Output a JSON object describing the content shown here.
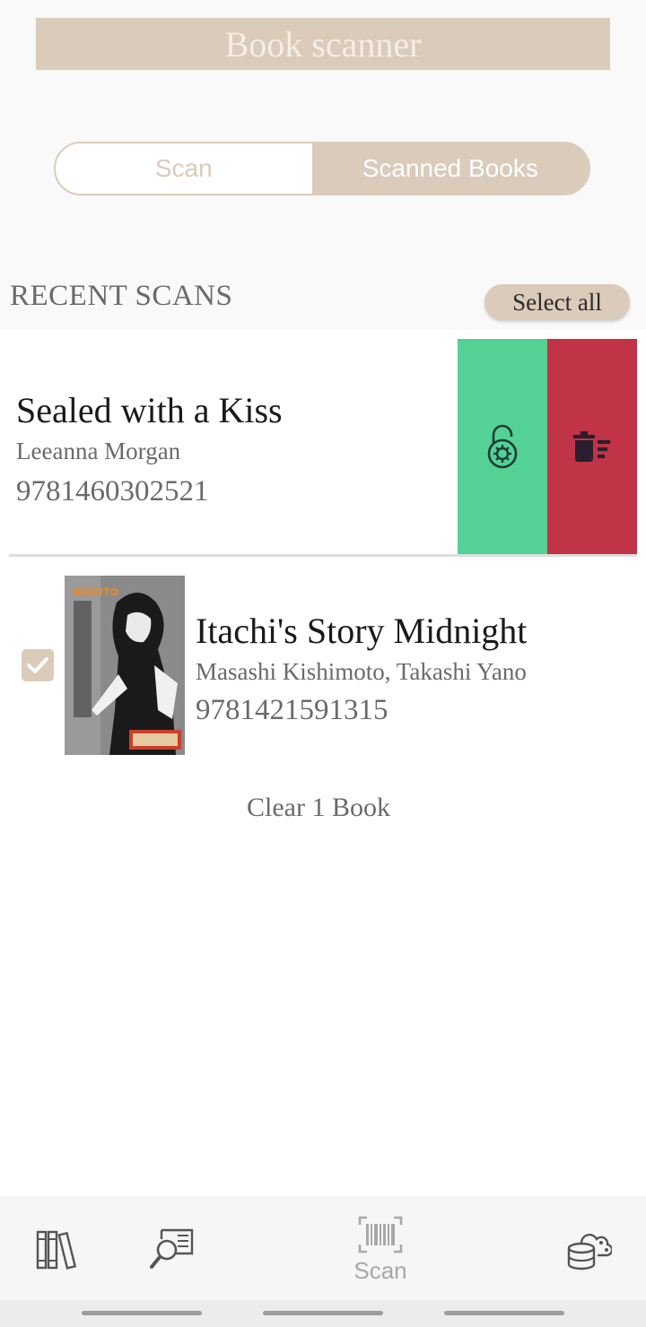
{
  "header": {
    "title": "Book scanner"
  },
  "tabs": {
    "scan": "Scan",
    "scanned_books": "Scanned Books"
  },
  "recent": {
    "label": "RECENT SCANS",
    "select_all": "Select all"
  },
  "books": [
    {
      "title": "Sealed with a Kiss",
      "author": "Leeanna Morgan",
      "isbn": "9781460302521"
    },
    {
      "title": "Itachi's Story Midnight",
      "author": "Masashi Kishimoto, Takashi Yano",
      "isbn": "9781421591315",
      "checked": true
    }
  ],
  "clear_button": "Clear 1 Book",
  "nav": {
    "scan_label": "Scan"
  },
  "colors": {
    "accent": "#dacbba",
    "unlock": "#54d296",
    "delete": "#c13346"
  },
  "icons": [
    "unlock-icon",
    "delete-icon",
    "check-icon",
    "library-icon",
    "search-book-icon",
    "barcode-icon",
    "cloud-database-icon"
  ]
}
